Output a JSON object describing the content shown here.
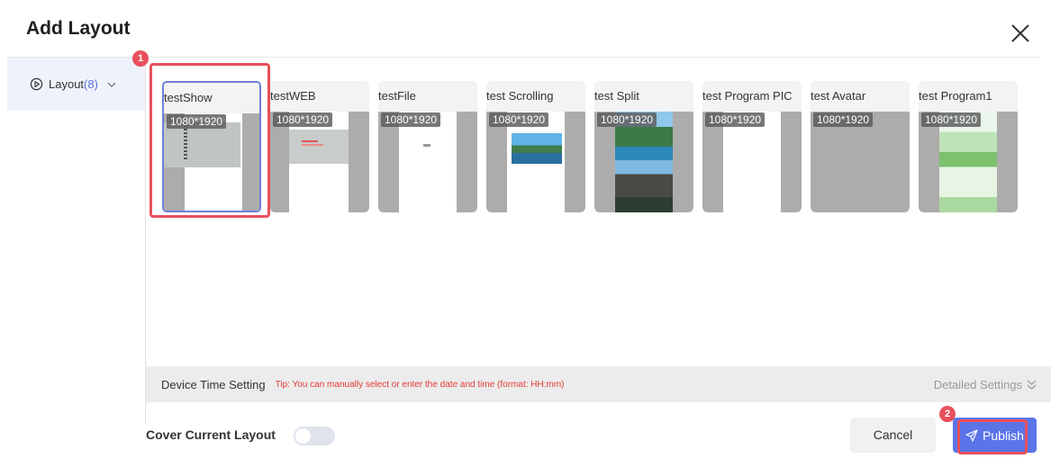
{
  "dialog": {
    "title": "Add Layout"
  },
  "sidebar": {
    "label": "Layout",
    "count": "(8)"
  },
  "resolution": "1080*1920",
  "cards": [
    {
      "name": "testShow",
      "preview": "gray-panel"
    },
    {
      "name": "testWEB",
      "preview": "web-page"
    },
    {
      "name": "testFile",
      "preview": "file"
    },
    {
      "name": "test Scrolling",
      "preview": "landscape"
    },
    {
      "name": "test Split",
      "preview": "mountains"
    },
    {
      "name": "test Program PIC",
      "preview": "blank"
    },
    {
      "name": "test Avatar",
      "preview": "gray"
    },
    {
      "name": "test Program1",
      "preview": "green-poster"
    }
  ],
  "time_setting": {
    "label": "Device Time Setting",
    "tip": "Tip: You can manually select or enter the date and time (format: HH:mm)",
    "details": "Detailed Settings"
  },
  "cover": {
    "label": "Cover Current Layout",
    "enabled": false
  },
  "buttons": {
    "cancel": "Cancel",
    "publish": "Publish"
  },
  "steps": {
    "one": "1",
    "two": "2"
  },
  "colors": {
    "accent": "#5b74e8",
    "annotation": "#e8505b",
    "tip": "#e53935"
  }
}
